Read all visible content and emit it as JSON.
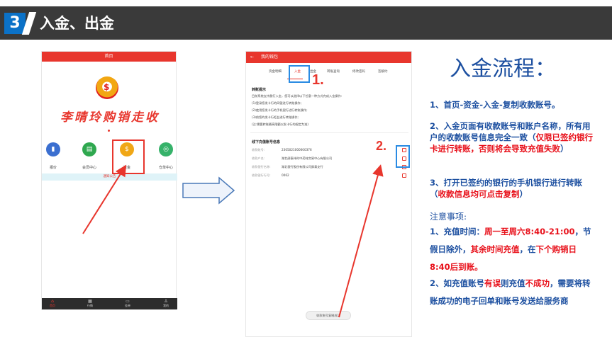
{
  "header": {
    "number": "3",
    "title": "入金、出金"
  },
  "phone1": {
    "title": "首页",
    "brand": "李晴玲购销走收",
    "logo_glyph": "$",
    "icons": [
      {
        "name": "chart-icon",
        "glyph": "▮",
        "label": "报价",
        "color": "#3b6fd0"
      },
      {
        "name": "mall-icon",
        "glyph": "▤",
        "label": "会员中心",
        "color": "#2fa84f"
      },
      {
        "name": "money-bag-icon",
        "glyph": "$",
        "label": "资金",
        "color": "#f0a716"
      },
      {
        "name": "ad-icon",
        "glyph": "◎",
        "label": "仓单中心",
        "color": "#36b26a"
      }
    ],
    "notice": "通知公告",
    "tabs": [
      {
        "label": "首页",
        "icon": "⌂",
        "active": true
      },
      {
        "label": "行情",
        "icon": "▦",
        "active": false
      },
      {
        "label": "挂单",
        "icon": "▭",
        "active": false
      },
      {
        "label": "我的",
        "icon": "♙",
        "active": false
      }
    ]
  },
  "phone2": {
    "title": "我的钱包",
    "back": "←",
    "tabs": [
      "资金明细",
      "入金",
      "出金",
      "转账查询",
      "修改密码",
      "签解约"
    ],
    "transfer_heading": "转账提示",
    "transfer_lines": [
      "目前系统支持我行入金，您可以选择以下任意一种方式完成入金操作:",
      "(1)登录您发卡行的网银进行转账操作;",
      "(2)使用您发卡行的手机银行进行转账操作;",
      "(3)前您的发卡行柜台进行转账操作;",
      "(注:需要转账最高限额以发卡行的规定为准)"
    ],
    "account_heading": "线下充值账号信息",
    "rows": [
      {
        "key": "收款账号:",
        "value": "2305021000000376"
      },
      {
        "key": "收款户名:",
        "value": "湖北郧泰伟时中药材交易中心有限公司"
      },
      {
        "key": "收款银行名称:",
        "value": "湖北银行股份有限公司郧泰支行"
      },
      {
        "key": "收款银行行号:",
        "value": "0062"
      }
    ],
    "copy_button": "收款账号复制成功"
  },
  "markers": {
    "m1": "1.",
    "m2": "2."
  },
  "right": {
    "flow_title": "入金流程：",
    "step1": "1、首页-资金-入金-复制收款账号。",
    "step2_a": "2、入金页面有收款账号和账户名称，所有用户的收款账号信息完全一致（",
    "step2_b": "仅限已签约银行卡进行转账，否则将会导致充值失败",
    "step2_c": "）",
    "step3_a": "3、打开已签约的银行的手机银行进行转账（",
    "step3_b": "收款信息均可点击复制",
    "step3_c": "）",
    "notes_title": "注意事项:",
    "note1_a": "1、充值时间：",
    "note1_b": "周一至周六",
    "note1_c": "8:40-21:00",
    "note1_d": "，节假日除外，",
    "note1_e": "其余时间充值",
    "note1_f": "，在",
    "note1_g": "下个购销日8:40后到账。",
    "note2_a": "2、如充值账号",
    "note2_b": "有误",
    "note2_c": "则充值",
    "note2_d": "不成功",
    "note2_e": "，需要将转账成功的电子回单和账号发送给服务商"
  }
}
